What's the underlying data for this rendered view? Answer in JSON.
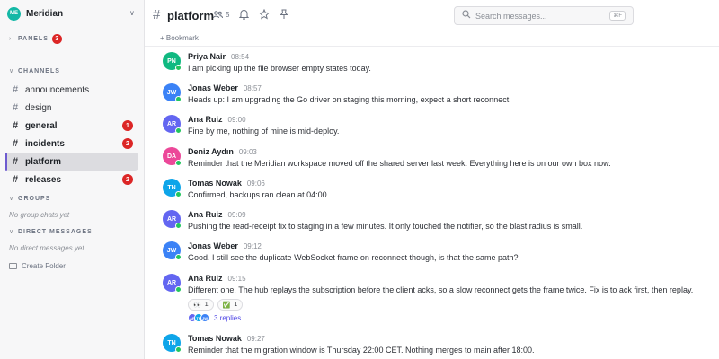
{
  "workspace": {
    "initials": "ME",
    "name": "Meridian"
  },
  "panels": {
    "label": "PANELS",
    "count": "3"
  },
  "sections": {
    "channels": "CHANNELS",
    "groups": "GROUPS",
    "direct": "DIRECT MESSAGES"
  },
  "channels": [
    {
      "name": "announcements",
      "badge": ""
    },
    {
      "name": "design",
      "badge": ""
    },
    {
      "name": "general",
      "badge": "1"
    },
    {
      "name": "incidents",
      "badge": "2"
    },
    {
      "name": "platform",
      "badge": ""
    },
    {
      "name": "releases",
      "badge": "2"
    }
  ],
  "empty": {
    "groups": "No group chats yet",
    "direct": "No direct messages yet"
  },
  "create_folder": "Create Folder",
  "header": {
    "hash": "#",
    "title": "platform",
    "members": "5"
  },
  "search": {
    "placeholder": "Search messages...",
    "shortcut": "⌘F"
  },
  "bookmark": "+ Bookmark",
  "messages": [
    {
      "initials": "PN",
      "author": "Priya Nair",
      "time": "08:54",
      "text": "I am picking up the file browser empty states today."
    },
    {
      "initials": "JW",
      "author": "Jonas Weber",
      "time": "08:57",
      "text": "Heads up: I am upgrading the Go driver on staging this morning, expect a short reconnect."
    },
    {
      "initials": "AR",
      "author": "Ana Ruiz",
      "time": "09:00",
      "text": "Fine by me, nothing of mine is mid-deploy."
    },
    {
      "initials": "DA",
      "author": "Deniz Aydın",
      "time": "09:03",
      "text": "Reminder that the Meridian workspace moved off the shared server last week. Everything here is on our own box now."
    },
    {
      "initials": "TN",
      "author": "Tomas Nowak",
      "time": "09:06",
      "text": "Confirmed, backups ran clean at 04:00."
    },
    {
      "initials": "AR",
      "author": "Ana Ruiz",
      "time": "09:09",
      "text": "Pushing the read-receipt fix to staging in a few minutes. It only touched the notifier, so the blast radius is small."
    },
    {
      "initials": "JW",
      "author": "Jonas Weber",
      "time": "09:12",
      "text": "Good. I still see the duplicate WebSocket frame on reconnect though, is that the same path?"
    },
    {
      "initials": "AR",
      "author": "Ana Ruiz",
      "time": "09:15",
      "text": "Different one. The hub replays the subscription before the client acks, so a slow reconnect gets the frame twice. Fix is to ack first, then replay."
    },
    {
      "initials": "TN",
      "author": "Tomas Nowak",
      "time": "09:27",
      "text": "Reminder that the migration window is Thursday 22:00 CET. Nothing merges to main after 18:00."
    }
  ],
  "reactions": [
    {
      "emoji": "👀",
      "count": "1"
    },
    {
      "emoji": "✅",
      "count": "1"
    }
  ],
  "thread": {
    "avatars": [
      "AR",
      "TN",
      "JW"
    ],
    "label": "3 replies"
  },
  "colors": {
    "PN": "#10b981",
    "JW": "#3b82f6",
    "AR": "#6366f1",
    "DA": "#ec4899",
    "TN": "#0ea5e9",
    "accent": "#6d5bd0",
    "badge": "#dc2626"
  }
}
